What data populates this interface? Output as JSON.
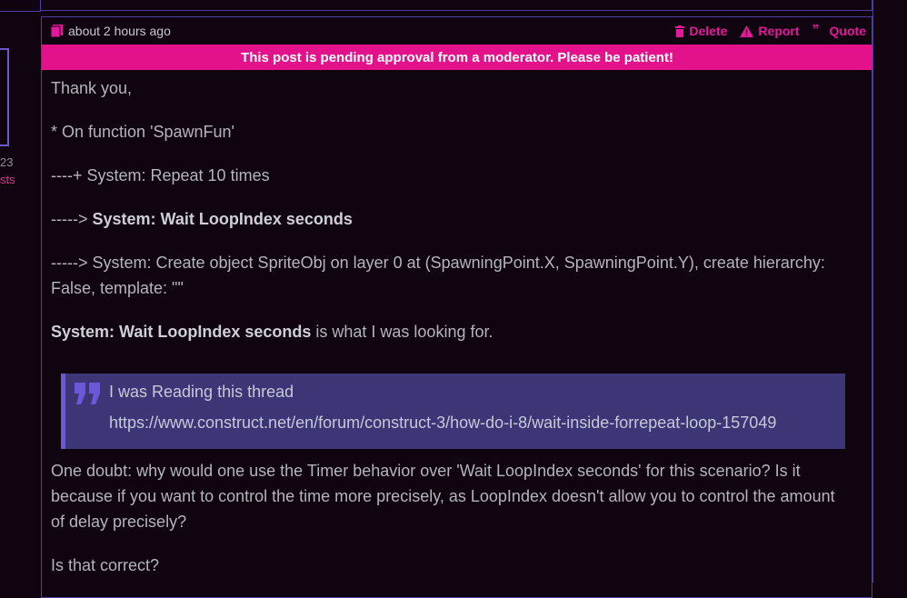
{
  "sidebar": {
    "date_fragment": "23",
    "posts_fragment": "sts"
  },
  "post": {
    "time": "about 2 hours ago",
    "actions": {
      "delete": "Delete",
      "report": "Report",
      "quote": "Quote"
    },
    "pending_notice": "This post is pending approval from a moderator. Please be patient!",
    "body": {
      "line1": "Thank you,",
      "line2": "* On function 'SpawnFun'",
      "line3": "----+ System: Repeat 10 times",
      "line4_prefix": "-----> ",
      "line4_bold": "System: Wait LoopIndex seconds",
      "line5": "-----> System: Create object SpriteObj on layer 0 at (SpawningPoint.X, SpawningPoint.Y), create hierarchy: False, template: \"\"",
      "line6_bold": "System: Wait LoopIndex seconds",
      "line6_rest": " is what I was looking for."
    },
    "quote": {
      "text": "I was Reading this thread",
      "link": "https://www.construct.net/en/forum/construct-3/how-do-i-8/wait-inside-forrepeat-loop-157049"
    },
    "after": {
      "para1": "One doubt: why would one use the Timer behavior over 'Wait LoopIndex seconds' for this scenario? Is it because if you want to control the time more precisely, as LoopIndex doesn't allow you to control the amount of delay precisely?",
      "para2": "Is that correct?"
    }
  },
  "colors": {
    "accent": "#e3128a",
    "border": "#4b3fa0",
    "quote_bg": "#3c3576"
  }
}
